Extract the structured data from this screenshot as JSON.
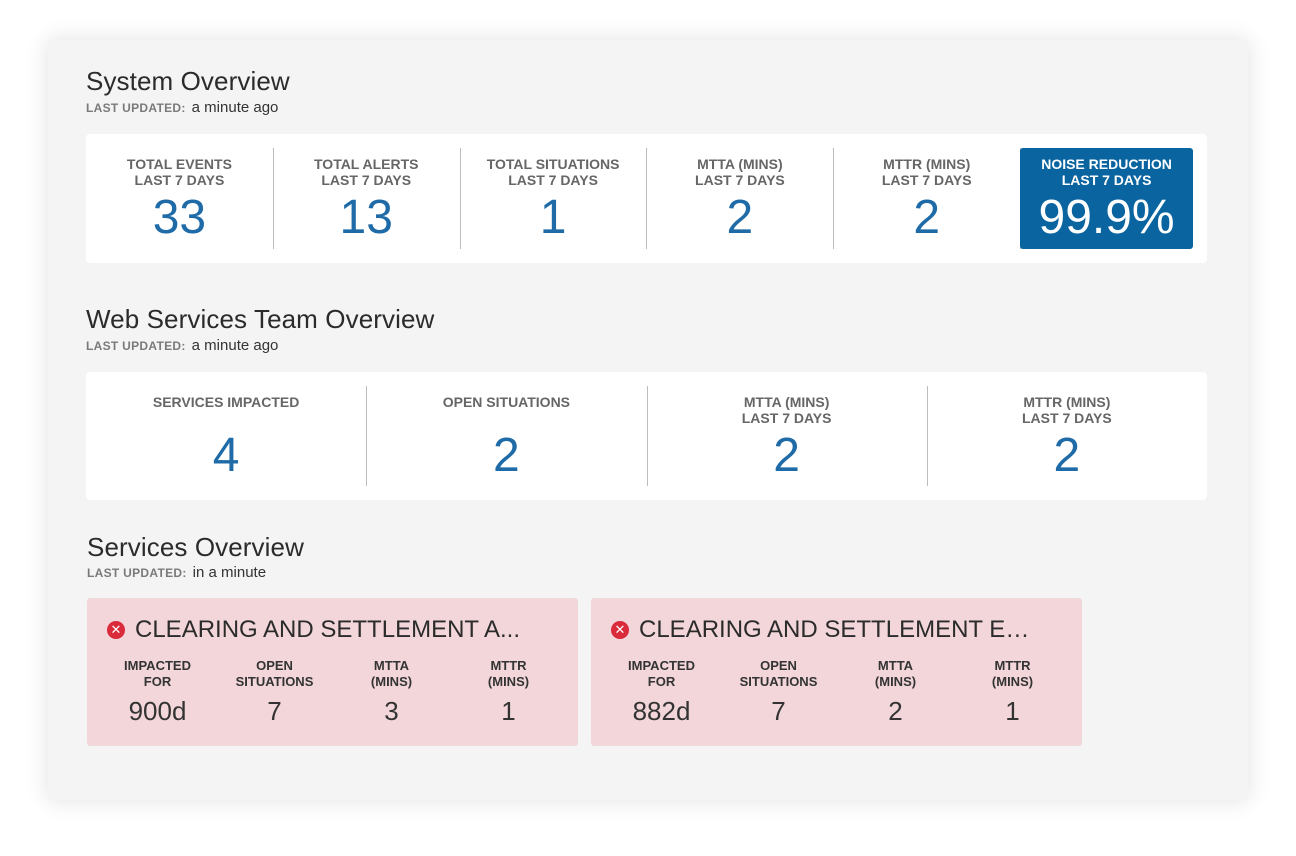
{
  "system": {
    "title": "System Overview",
    "updated_label": "LAST UPDATED:",
    "updated_value": "a minute ago",
    "stats": [
      {
        "label1": "TOTAL EVENTS",
        "label2": "LAST 7 DAYS",
        "value": "33"
      },
      {
        "label1": "TOTAL ALERTS",
        "label2": "LAST 7 DAYS",
        "value": "13"
      },
      {
        "label1": "TOTAL SITUATIONS",
        "label2": "LAST 7 DAYS",
        "value": "1"
      },
      {
        "label1": "MTTA (MINS)",
        "label2": "LAST 7 DAYS",
        "value": "2"
      },
      {
        "label1": "MTTR (MINS)",
        "label2": "LAST 7 DAYS",
        "value": "2"
      },
      {
        "label1": "NOISE REDUCTION",
        "label2": "LAST 7 DAYS",
        "value": "99.9%"
      }
    ]
  },
  "team": {
    "title": "Web Services Team Overview",
    "updated_label": "LAST UPDATED:",
    "updated_value": "a minute ago",
    "stats": [
      {
        "label1": "SERVICES IMPACTED",
        "label2": "",
        "value": "4"
      },
      {
        "label1": "OPEN SITUATIONS",
        "label2": "",
        "value": "2"
      },
      {
        "label1": "MTTA (MINS)",
        "label2": "LAST 7 DAYS",
        "value": "2"
      },
      {
        "label1": "MTTR (MINS)",
        "label2": "LAST 7 DAYS",
        "value": "2"
      }
    ]
  },
  "services": {
    "title": "Services Overview",
    "updated_label": "LAST UPDATED:",
    "updated_value": "in a minute",
    "metric_labels": {
      "impacted_1": "IMPACTED",
      "impacted_2": "FOR",
      "open_1": "OPEN",
      "open_2": "SITUATIONS",
      "mtta_1": "MTTA",
      "mtta_2": "(MINS)",
      "mttr_1": "MTTR",
      "mttr_2": "(MINS)"
    },
    "cards": [
      {
        "name": "CLEARING AND SETTLEMENT A...",
        "impacted": "900d",
        "open": "7",
        "mtta": "3",
        "mttr": "1"
      },
      {
        "name": "CLEARING AND SETTLEMENT EM...",
        "impacted": "882d",
        "open": "7",
        "mtta": "2",
        "mttr": "1"
      }
    ]
  },
  "colors": {
    "accent": "#0a64a0",
    "value_blue": "#1e6ba8",
    "error_red": "#d92b3a",
    "service_card_bg": "#f2d6da"
  },
  "icons": {
    "service_status": "error-circle-icon"
  }
}
